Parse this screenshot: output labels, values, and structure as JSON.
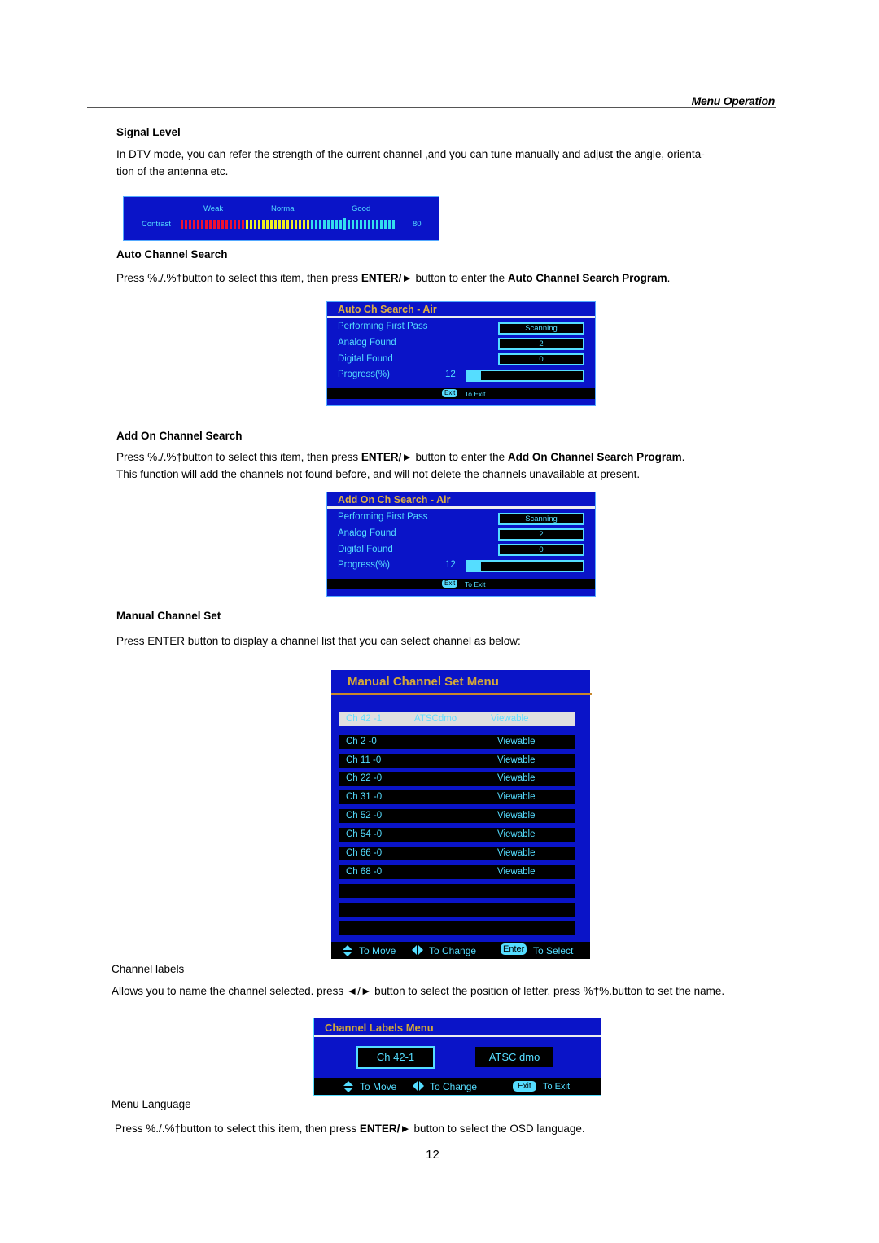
{
  "header": {
    "section_title": "Menu Operation"
  },
  "signal_level": {
    "heading": "Signal Level",
    "body": "In DTV mode, you can refer the strength of the current channel ,and you can tune manually and adjust the angle, orienta-tion of the antenna etc.",
    "body_line1": "In DTV mode, you can refer the strength of the current channel ,and you can tune manually and adjust the angle, orienta-",
    "body_line2": "tion of the antenna etc.",
    "osd": {
      "labels": [
        "Weak",
        "Normal",
        "Good"
      ],
      "row_label": "Contrast",
      "value": "80",
      "bar_segments": {
        "red": 16,
        "yellow": 16,
        "cyan": 21
      },
      "marker_fraction": 0.76,
      "colors": {
        "red": "#ee1133",
        "yellow": "#eeee22",
        "cyan": "#33ddee",
        "bg": "#0a14c8"
      }
    }
  },
  "auto_channel_search": {
    "heading": "Auto Channel Search",
    "body_pre": "Press %./.%†button to select this item, then press ",
    "body_bold1": "ENTER/►",
    "body_mid": " button to enter the ",
    "body_bold2": "Auto Channel Search Program",
    "body_post": ".",
    "osd": {
      "title": "Auto Ch Search - Air",
      "rows": [
        {
          "label": "Performing First Pass",
          "value": "Scanning"
        },
        {
          "label": "Analog  Found",
          "value": "2"
        },
        {
          "label": "Digital   Found",
          "value": "0"
        }
      ],
      "progress_label": "Progress(%)",
      "progress_value": "12",
      "progress_percent": 12,
      "footer_key": "Exit",
      "footer_text": "To Exit"
    }
  },
  "add_on_channel_search": {
    "heading": "Add On Channel Search",
    "body_pre": "Press %./.%†button to select this item, then press ",
    "body_bold1": "ENTER/►",
    "body_mid": " button to enter the ",
    "body_bold2": "Add On Channel Search Program",
    "body_post": ".",
    "body_line2": "This  function will add the channels not found before, and will not delete the channels unavailable at present.",
    "osd": {
      "title": "Add On Ch Search - Air",
      "rows": [
        {
          "label": "Performing First Pass",
          "value": "Scanning"
        },
        {
          "label": "Analog  Found",
          "value": "2"
        },
        {
          "label": "Digital  Found",
          "value": "0"
        }
      ],
      "progress_label": "Progress(%)",
      "progress_value": "12",
      "progress_percent": 12,
      "footer_key": "Exit",
      "footer_text": "To Exit"
    }
  },
  "manual_channel_set": {
    "heading": "Manual Channel Set",
    "body": "Press ENTER button to display a channel list that you can select channel as below:",
    "osd": {
      "title": "Manual Channel Set  Menu",
      "selected": {
        "channel": "Ch 42 -1",
        "name": "ATSCdmo",
        "status": "Viewable"
      },
      "channels": [
        {
          "channel": "Ch 2 -0",
          "status": "Viewable"
        },
        {
          "channel": "Ch 11 -0",
          "status": "Viewable"
        },
        {
          "channel": "Ch 22 -0",
          "status": "Viewable"
        },
        {
          "channel": "Ch 31 -0",
          "status": "Viewable"
        },
        {
          "channel": "Ch 52 -0",
          "status": "Viewable"
        },
        {
          "channel": "Ch 54 -0",
          "status": "Viewable"
        },
        {
          "channel": "Ch 66 -0",
          "status": "Viewable"
        },
        {
          "channel": "Ch 68 -0",
          "status": "Viewable"
        },
        {
          "channel": "",
          "status": ""
        },
        {
          "channel": "",
          "status": ""
        },
        {
          "channel": "",
          "status": ""
        }
      ],
      "footer": {
        "move": "To Move",
        "change": "To Change",
        "enter_key": "Enter",
        "select": "To Select"
      }
    }
  },
  "channel_labels": {
    "heading": "Channel labels",
    "body": "Allows you to name the channel selected. press ◄/► button to select the position of letter, press %†%.button to set the name.",
    "osd": {
      "title": "Channel Labels  Menu",
      "channel": "Ch 42-1",
      "name": "ATSC dmo",
      "footer": {
        "move": "To Move",
        "change": "To Change",
        "exit_key": "Exit",
        "exit": "To Exit"
      }
    }
  },
  "menu_language": {
    "heading": "Menu Language",
    "body_pre": "Press %./.%†button to select this item, then press ",
    "body_bold": "ENTER/►",
    "body_post": " button to select the OSD language."
  },
  "page_number": "12"
}
